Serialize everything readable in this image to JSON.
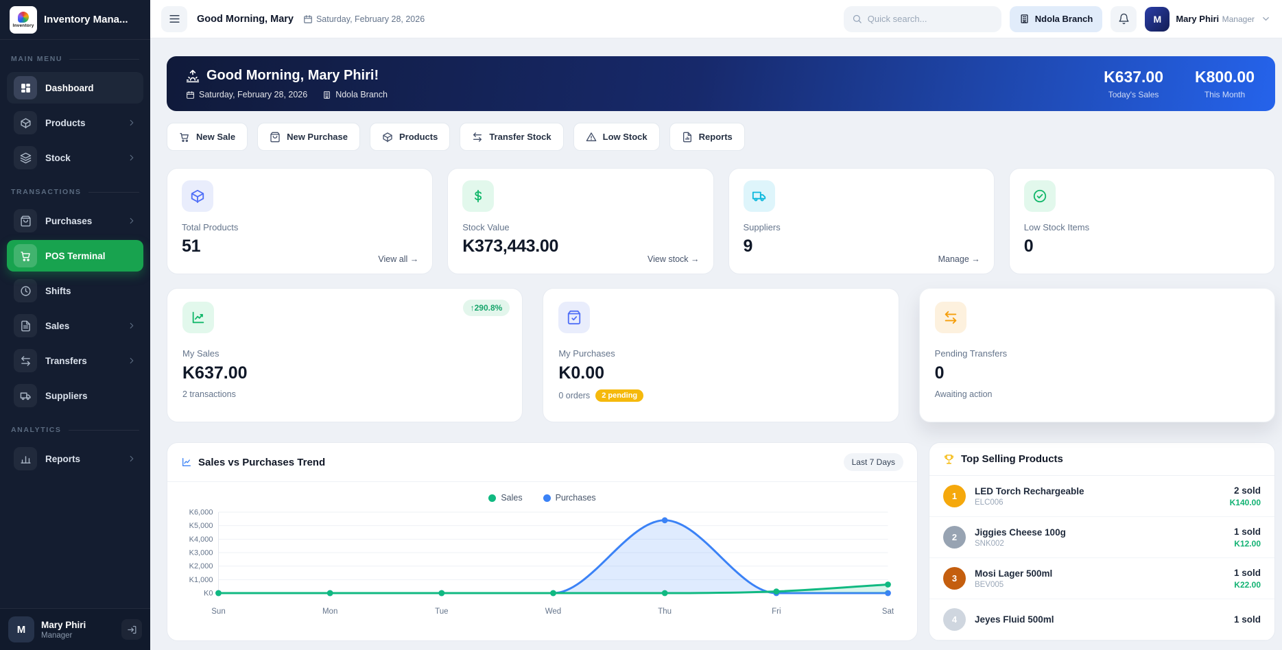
{
  "app": {
    "title": "Inventory Mana...",
    "logo_word": "Inventory"
  },
  "sidebar": {
    "sections": [
      {
        "label": "MAIN MENU",
        "items": [
          {
            "label": "Dashboard",
            "icon": "dashboard",
            "active": true
          },
          {
            "label": "Products",
            "icon": "package",
            "chevron": true
          },
          {
            "label": "Stock",
            "icon": "layers",
            "chevron": true
          }
        ]
      },
      {
        "label": "TRANSACTIONS",
        "items": [
          {
            "label": "Purchases",
            "icon": "bag",
            "chevron": true
          },
          {
            "label": "POS Terminal",
            "icon": "cart",
            "highlight": true
          },
          {
            "label": "Shifts",
            "icon": "clock"
          },
          {
            "label": "Sales",
            "icon": "receipt",
            "chevron": true
          },
          {
            "label": "Transfers",
            "icon": "transfer",
            "chevron": true
          },
          {
            "label": "Suppliers",
            "icon": "truck"
          }
        ]
      },
      {
        "label": "ANALYTICS",
        "items": [
          {
            "label": "Reports",
            "icon": "chart-bars",
            "chevron": true
          }
        ]
      }
    ],
    "user": {
      "initial": "M",
      "name": "Mary Phiri",
      "role": "Manager"
    }
  },
  "topbar": {
    "greeting": "Good Morning, Mary",
    "date": "Saturday, February 28, 2026",
    "search_placeholder": "Quick search...",
    "branch": "Ndola Branch",
    "user_initial": "M",
    "user_name": "Mary Phiri",
    "user_role": "Manager"
  },
  "banner": {
    "greeting": "Good Morning, Mary Phiri!",
    "date": "Saturday, February 28, 2026",
    "branch": "Ndola Branch",
    "stats": [
      {
        "value": "K637.00",
        "label": "Today's Sales"
      },
      {
        "value": "K800.00",
        "label": "This Month"
      }
    ]
  },
  "quick_actions": [
    {
      "label": "New Sale",
      "icon": "cart"
    },
    {
      "label": "New Purchase",
      "icon": "bag"
    },
    {
      "label": "Products",
      "icon": "package"
    },
    {
      "label": "Transfer Stock",
      "icon": "transfer"
    },
    {
      "label": "Low Stock",
      "icon": "warning"
    },
    {
      "label": "Reports",
      "icon": "doc-report"
    }
  ],
  "stat_cards": [
    {
      "label": "Total Products",
      "value": "51",
      "link": "View all →",
      "icon": "package",
      "fg": "#4f6ef7",
      "bg": "#e9edfc"
    },
    {
      "label": "Stock Value",
      "value": "K373,443.00",
      "link": "View stock →",
      "icon": "dollar",
      "fg": "#12b76a",
      "bg": "#e2f8ec"
    },
    {
      "label": "Suppliers",
      "value": "9",
      "link": "Manage →",
      "icon": "truck",
      "fg": "#0cb8dd",
      "bg": "#def5fb"
    },
    {
      "label": "Low Stock Items",
      "value": "0",
      "link": "",
      "icon": "check-circle",
      "fg": "#12b76a",
      "bg": "#e2f8ec"
    }
  ],
  "perf_cards": [
    {
      "label": "My Sales",
      "value": "K637.00",
      "sub": "2 transactions",
      "badge": "↑290.8%",
      "icon": "trend",
      "fg": "#12b76a",
      "bg": "#e2f8ec"
    },
    {
      "label": "My Purchases",
      "value": "K0.00",
      "sub": "0 orders",
      "pending": "2 pending",
      "icon": "bag-check",
      "fg": "#4f6ef7",
      "bg": "#e9edfc"
    },
    {
      "label": "Pending Transfers",
      "value": "0",
      "sub": "Awaiting action",
      "icon": "transfer",
      "fg": "#f59e0b",
      "bg": "#fdf1de",
      "elevated": true
    }
  ],
  "chart_data": {
    "type": "line",
    "title": "Sales vs Purchases Trend",
    "period": "Last 7 Days",
    "x": [
      "Sun",
      "Mon",
      "Tue",
      "Wed",
      "Thu",
      "Fri",
      "Sat"
    ],
    "series": [
      {
        "name": "Sales",
        "color": "#10b981",
        "values": [
          0,
          0,
          0,
          0,
          0,
          120,
          637
        ]
      },
      {
        "name": "Purchases",
        "color": "#3b82f6",
        "values": [
          0,
          0,
          0,
          0,
          5400,
          0,
          0
        ]
      }
    ],
    "ylim": [
      0,
      6000
    ],
    "yticks": [
      "K0",
      "K1,000",
      "K2,000",
      "K3,000",
      "K4,000",
      "K5,000",
      "K6,000"
    ],
    "grid": true,
    "legend_position": "top-center"
  },
  "top_selling": {
    "title": "Top Selling Products",
    "items": [
      {
        "rank": "1",
        "name": "LED Torch Rechargeable",
        "code": "ELC006",
        "sold": "2 sold",
        "amount": "K140.00",
        "badge": "#f5a80c"
      },
      {
        "rank": "2",
        "name": "Jiggies Cheese 100g",
        "code": "SNK002",
        "sold": "1 sold",
        "amount": "K12.00",
        "badge": "#97a3b2"
      },
      {
        "rank": "3",
        "name": "Mosi Lager 500ml",
        "code": "BEV005",
        "sold": "1 sold",
        "amount": "K22.00",
        "badge": "#c45e0e"
      },
      {
        "rank": "4",
        "name": "Jeyes Fluid 500ml",
        "code": "",
        "sold": "1 sold",
        "amount": "",
        "badge": "#cfd6df"
      }
    ]
  },
  "colors": {
    "sales": "#10b981",
    "purchases": "#3b82f6",
    "sidebar_active_green": "#18a34f",
    "banner_blue": "#2563eb",
    "amber": "#f5b90c"
  }
}
